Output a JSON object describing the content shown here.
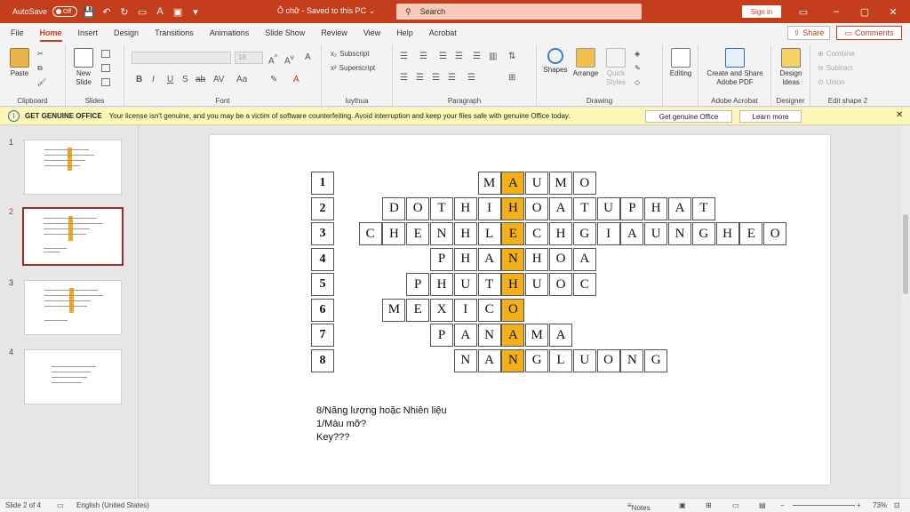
{
  "titlebar": {
    "autosave": "AutoSave",
    "toggle": "Off",
    "doc_title": "Ô chữ  -  Saved to this PC  ⌄",
    "search": "Search",
    "signin": "Sign in"
  },
  "tabs": [
    "File",
    "Home",
    "Insert",
    "Design",
    "Transitions",
    "Animations",
    "Slide Show",
    "Review",
    "View",
    "Help",
    "Acrobat"
  ],
  "share": "Share",
  "comments": "Comments",
  "ribbon": {
    "paste": "Paste",
    "clipboard": "Clipboard",
    "new_slide": "New Slide",
    "slides": "Slides",
    "font_size": "18",
    "font": "Font",
    "subscript": "Subscript",
    "superscript": "Superscript",
    "luythua": "luythua",
    "paragraph": "Paragraph",
    "shapes": "Shapes",
    "arrange": "Arrange",
    "quick_styles": "Quick Styles",
    "drawing": "Drawing",
    "editing": "Editing",
    "create_share": "Create and Share Adobe PDF",
    "adobe_acrobat": "Adobe Acrobat",
    "design_ideas": "Design Ideas",
    "designer": "Designer",
    "combine": "Combine",
    "subtract": "Subtract",
    "union": "Union",
    "edit_shape": "Edit shape 2"
  },
  "notice": {
    "title": "GET GENUINE OFFICE",
    "message": "Your license isn't genuine, and you may be a victim of software counterfeiting. Avoid interruption and keep your files safe with genuine Office today.",
    "btn1": "Get genuine Office",
    "btn2": "Learn more"
  },
  "thumbnails": [
    "1",
    "2",
    "3",
    "4"
  ],
  "crossword": {
    "rows": [
      {
        "num": "1",
        "start": 7,
        "letters": "MAUMO"
      },
      {
        "num": "2",
        "start": 3,
        "letters": "DOTHIHOATUPHAT"
      },
      {
        "num": "3",
        "start": 2,
        "letters": "CHENHLECHGIAUNGHEO"
      },
      {
        "num": "4",
        "start": 5,
        "letters": "PHANHOA"
      },
      {
        "num": "5",
        "start": 4,
        "letters": "PHUTHUOC"
      },
      {
        "num": "6",
        "start": 3,
        "letters": "MEXICO"
      },
      {
        "num": "7",
        "start": 5,
        "letters": "PANAMA"
      },
      {
        "num": "8",
        "start": 6,
        "letters": "NANGLUONG"
      }
    ],
    "key_column": 8,
    "key_color": "#f4b018"
  },
  "clues": [
    "8/Năng lượng hoặc Nhiên liệu",
    "1/Màu mỡ?",
    "Key???"
  ],
  "status": {
    "slide": "Slide 2 of 4",
    "language": "English (United States)",
    "notes": "Notes",
    "zoom": "73%"
  }
}
